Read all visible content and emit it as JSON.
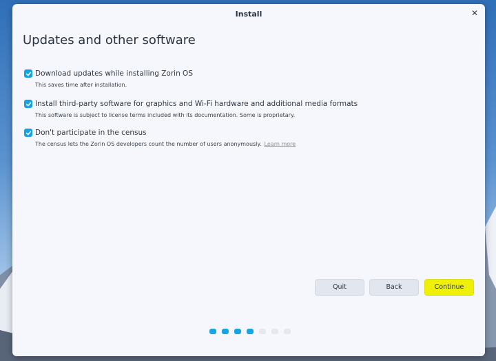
{
  "window": {
    "title": "Install",
    "close_glyph": "✕"
  },
  "page": {
    "title": "Updates and other software"
  },
  "options": [
    {
      "label": "Download updates while installing Zorin OS",
      "description": "This saves time after installation.",
      "checked": true
    },
    {
      "label": "Install third-party software for graphics and Wi-Fi hardware and additional media formats",
      "description": "This software is subject to license terms included with its documentation. Some is proprietary.",
      "checked": true
    },
    {
      "label": "Don't participate in the census",
      "description": "The census lets the Zorin OS developers count the number of users anonymously.",
      "link": "Learn more",
      "checked": true
    }
  ],
  "buttons": {
    "quit": "Quit",
    "back": "Back",
    "continue": "Continue"
  },
  "progress": {
    "total_steps": 7,
    "completed_steps": 4
  },
  "colors": {
    "accent": "#18a3e2",
    "continue_button": "#eef00a",
    "window_background": "#f5f7fc"
  },
  "icons": {
    "checkbox": "check-icon",
    "close": "close-icon"
  }
}
